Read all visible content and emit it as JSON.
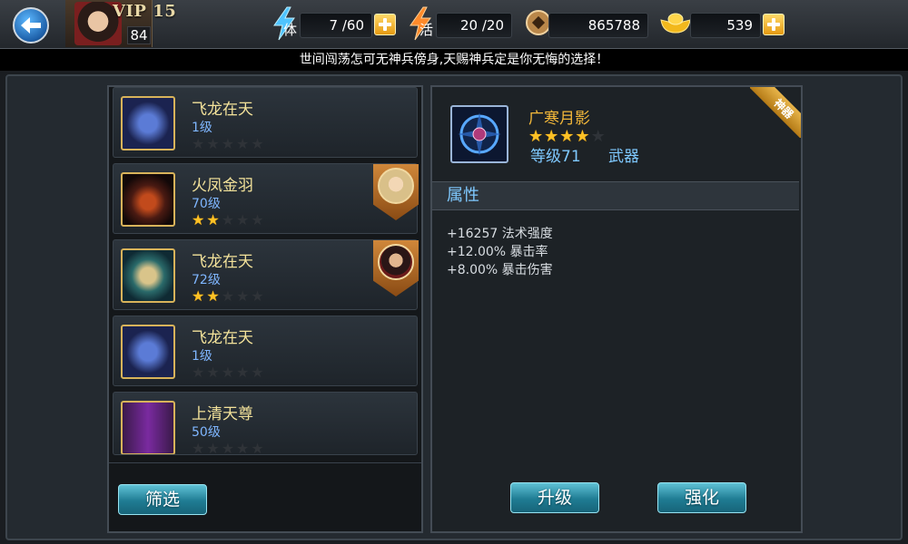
{
  "header": {
    "vip_label": "VIP 15",
    "player_level": "84",
    "stamina": {
      "label": "体",
      "value": "7 /60"
    },
    "vitality": {
      "label": "活",
      "value": "20 /20"
    },
    "coins": "865788",
    "ingots": "539"
  },
  "notice": "世间闯荡怎可无神兵傍身,天赐神兵定是你无悔的选择！",
  "weapon_list": [
    {
      "name": "飞龙在天",
      "level": "1级",
      "stars": 0,
      "has_owner": false
    },
    {
      "name": "火凤金羽",
      "level": "70级",
      "stars": 2,
      "has_owner": true
    },
    {
      "name": "飞龙在天",
      "level": "72级",
      "stars": 2,
      "has_owner": true
    },
    {
      "name": "飞龙在天",
      "level": "1级",
      "stars": 0,
      "has_owner": false
    },
    {
      "name": "上清天尊",
      "level": "50级",
      "stars": 0,
      "has_owner": false
    }
  ],
  "buttons": {
    "filter": "筛选",
    "upgrade": "升级",
    "enhance": "强化"
  },
  "detail": {
    "name": "广寒月影",
    "stars": 4,
    "max_stars": 5,
    "level": "等级71",
    "type": "武器",
    "ribbon": "神器",
    "attributes_header": "属性",
    "attributes": [
      "+16257 法术强度",
      "+12.00% 暴击率",
      "+8.00% 暴击伤害"
    ]
  },
  "colors": {
    "gold": "#f3e29a",
    "level_blue": "#7fb6ff",
    "button_teal": "#1f7c93",
    "star": "#ffc125"
  }
}
